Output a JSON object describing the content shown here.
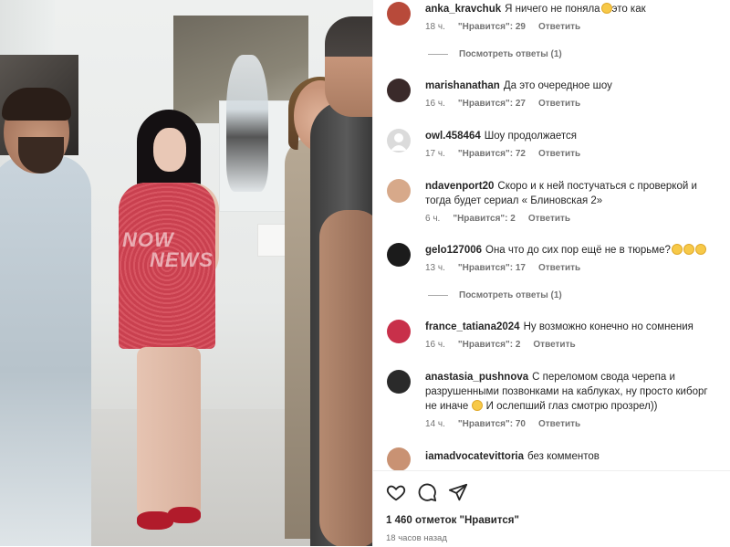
{
  "photo": {
    "watermark_line1": "NOW",
    "watermark_line2": "NEWS"
  },
  "comments": [
    {
      "username": "anka_kravchuk",
      "text": "Я ничего не поняла",
      "text_after": "это как",
      "emoji": "😯",
      "time": "18 ч.",
      "likes": "\"Нравится\": 29",
      "reply_label": "Ответить",
      "avatar_color": "#b84a3a"
    },
    {
      "username": "marishanathan",
      "text": "Да это очередное шоу",
      "time": "16 ч.",
      "likes": "\"Нравится\": 27",
      "reply_label": "Ответить",
      "avatar_color": "#3a2a2a"
    },
    {
      "username": "owl.458464",
      "text": "Шоу продолжается",
      "time": "17 ч.",
      "likes": "\"Нравится\": 72",
      "reply_label": "Ответить",
      "avatar_color": "#dbdbdb"
    },
    {
      "username": "ndavenport20",
      "text": "Скоро и к ней постучаться с проверкой и тогда будет сериал « Блиновская 2»",
      "time": "6 ч.",
      "likes": "\"Нравится\": 2",
      "reply_label": "Ответить",
      "avatar_color": "#d7a98a"
    },
    {
      "username": "gelo127006",
      "text": "Она что до сих пор ещё не в тюрьме?",
      "emoji": "😮😮😮",
      "time": "13 ч.",
      "likes": "\"Нравится\": 17",
      "reply_label": "Ответить",
      "avatar_color": "#1b1b1b"
    },
    {
      "username": "france_tatiana2024",
      "text": "Ну возможно конечно но сомнения",
      "time": "16 ч.",
      "likes": "\"Нравится\": 2",
      "reply_label": "Ответить",
      "avatar_color": "#c8304a"
    },
    {
      "username": "anastasia_pushnova",
      "text": "С переломом свода черепа и разрушенными позвонками на каблуках, ну просто киборг не иначе",
      "text_after": "И ослепший глаз смотрю прозрел))",
      "emoji": "😁",
      "time": "14 ч.",
      "likes": "\"Нравится\": 70",
      "reply_label": "Ответить",
      "avatar_color": "#2a2a2a"
    },
    {
      "username": "iamadvocatevittoria",
      "text": "без комментов",
      "avatar_color": "#c99273"
    }
  ],
  "view_replies": [
    "Посмотреть ответы (1)",
    "Посмотреть ответы (1)"
  ],
  "actions": {
    "like_icon": "heart-icon",
    "comment_icon": "comment-icon",
    "share_icon": "share-icon"
  },
  "likes_count": "1 460 отметок \"Нравится\"",
  "post_time": "18 часов назад"
}
